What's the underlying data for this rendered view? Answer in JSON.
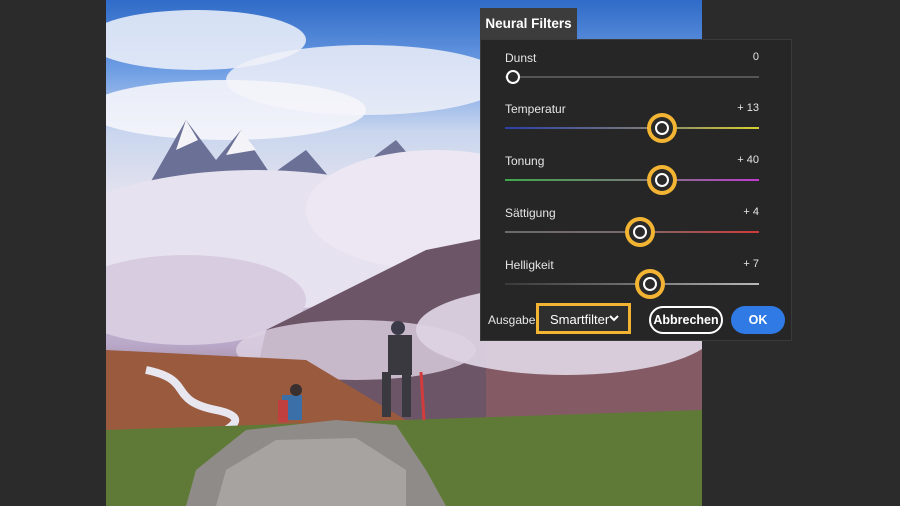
{
  "panel": {
    "title": "Neural Filters",
    "sliders": [
      {
        "label": "Dunst",
        "value": "0",
        "level": 0.03,
        "highlight": false
      },
      {
        "label": "Temperatur",
        "value": "+ 13",
        "level": 0.62,
        "highlight": true
      },
      {
        "label": "Tonung",
        "value": "+ 40",
        "level": 0.62,
        "highlight": true
      },
      {
        "label": "Sättigung",
        "value": "+ 4",
        "level": 0.53,
        "highlight": true
      },
      {
        "label": "Helligkeit",
        "value": "+ 7",
        "level": 0.57,
        "highlight": true
      }
    ],
    "output_label": "Ausgabe",
    "output_value": "Smartfilter",
    "cancel_label": "Abbrechen",
    "ok_label": "OK"
  },
  "colors": {
    "highlight": "#f2b432",
    "ok_button": "#2f7ae5",
    "panel_bg": "#262626"
  }
}
